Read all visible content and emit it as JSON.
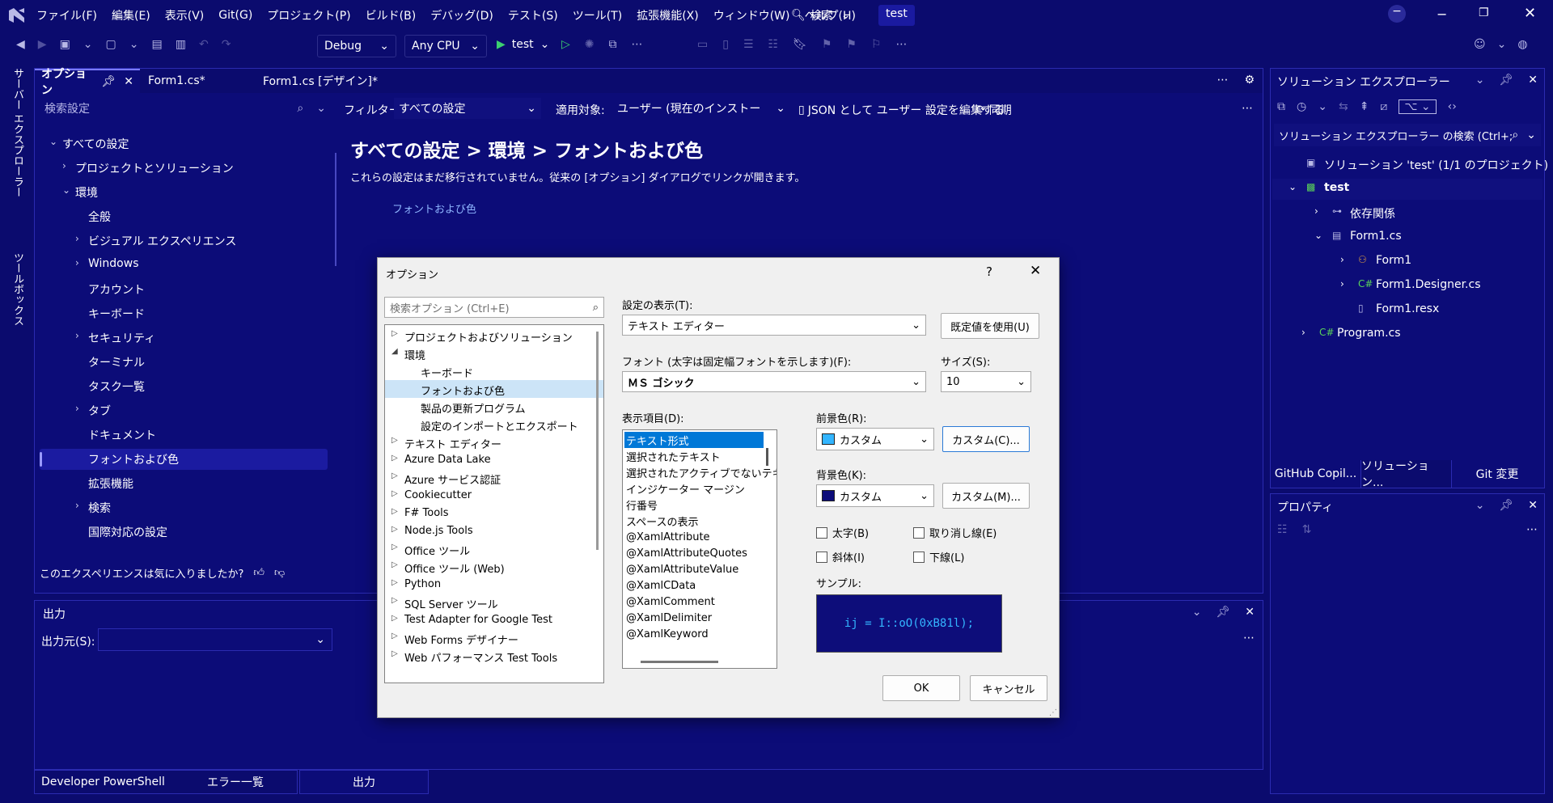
{
  "app": {
    "logo": "vs-logo-icon",
    "solution_name": "test"
  },
  "menu": [
    "ファイル(F)",
    "編集(E)",
    "表示(V)",
    "Git(G)",
    "プロジェクト(P)",
    "ビルド(B)",
    "デバッグ(D)",
    "テスト(S)",
    "ツール(T)",
    "拡張機能(X)",
    "ウィンドウ(W)",
    "ヘルプ(H)"
  ],
  "search_label": "検索",
  "toolbar": {
    "config": "Debug",
    "platform": "Any CPU",
    "run_target": "test"
  },
  "left_vertical_tabs": [
    "サーバー エクスプローラー",
    "ツールボックス"
  ],
  "doc_tabs": [
    {
      "label": "オプション"
    },
    {
      "label": "Form1.cs*"
    },
    {
      "label": "Form1.cs [デザイン]*"
    }
  ],
  "options_page": {
    "search_placeholder": "検索設定",
    "filter_label": "フィルター:",
    "filter_value": "すべての設定",
    "scope_label": "適用対象:",
    "scope_value": "ユーザー (現在のインストー",
    "json_edit": "JSON として ユーザー 設定を編集する",
    "sync": "同期",
    "breadcrumb": "すべての設定 > 環境 > フォントおよび色",
    "notice": "これらの設定はまだ移行されていません。従来の [オプション] ダイアログでリンクが開きます。",
    "link": "フォントおよび色",
    "feedback": "このエクスペリエンスは気に入りましたか?",
    "tree": [
      {
        "label": "すべての設定",
        "level": 0,
        "arrow": "v"
      },
      {
        "label": "プロジェクトとソリューション",
        "level": 1,
        "arrow": ">"
      },
      {
        "label": "環境",
        "level": 1,
        "arrow": "v"
      },
      {
        "label": "全般",
        "level": 2,
        "arrow": ""
      },
      {
        "label": "ビジュアル エクスペリエンス",
        "level": 2,
        "arrow": ">"
      },
      {
        "label": "Windows",
        "level": 2,
        "arrow": ">"
      },
      {
        "label": "アカウント",
        "level": 2,
        "arrow": ""
      },
      {
        "label": "キーボード",
        "level": 2,
        "arrow": ""
      },
      {
        "label": "セキュリティ",
        "level": 2,
        "arrow": ">"
      },
      {
        "label": "ターミナル",
        "level": 2,
        "arrow": ""
      },
      {
        "label": "タスク一覧",
        "level": 2,
        "arrow": ""
      },
      {
        "label": "タブ",
        "level": 2,
        "arrow": ">"
      },
      {
        "label": "ドキュメント",
        "level": 2,
        "arrow": ""
      },
      {
        "label": "フォントおよび色",
        "level": 2,
        "arrow": "",
        "selected": true
      },
      {
        "label": "拡張機能",
        "level": 2,
        "arrow": ""
      },
      {
        "label": "検索",
        "level": 2,
        "arrow": ">"
      },
      {
        "label": "国際対応の設定",
        "level": 2,
        "arrow": ""
      }
    ]
  },
  "output_panel": {
    "title": "出力",
    "source_label": "出力元(S):"
  },
  "bottom_tabs": [
    "Developer PowerShell",
    "エラー一覧",
    "出力"
  ],
  "solution_explorer": {
    "title": "ソリューション エクスプローラー",
    "search_placeholder": "ソリューション エクスプローラー の検索 (Ctrl+;)",
    "items": [
      {
        "label": "ソリューション 'test' (1/1 のプロジェクト)",
        "level": 0,
        "arrow": "",
        "icon": "solution-icon"
      },
      {
        "label": "test",
        "level": 0,
        "arrow": "v",
        "icon": "csharp-project-icon",
        "bold": true
      },
      {
        "label": "依存関係",
        "level": 1,
        "arrow": ">",
        "icon": "dependencies-icon"
      },
      {
        "label": "Form1.cs",
        "level": 1,
        "arrow": "v",
        "icon": "form-icon"
      },
      {
        "label": "Form1",
        "level": 2,
        "arrow": ">",
        "icon": "class-icon"
      },
      {
        "label": "Form1.Designer.cs",
        "level": 2,
        "arrow": ">",
        "icon": "csharp-file-icon"
      },
      {
        "label": "Form1.resx",
        "level": 2,
        "arrow": "",
        "icon": "resx-file-icon"
      },
      {
        "label": "Program.cs",
        "level": 0.5,
        "arrow": ">",
        "icon": "csharp-file-icon"
      }
    ],
    "tabs": [
      "GitHub Copil...",
      "ソリューション...",
      "Git 変更"
    ]
  },
  "properties": {
    "title": "プロパティ"
  },
  "dialog": {
    "title": "オプション",
    "help": "?",
    "search_placeholder": "検索オプション (Ctrl+E)",
    "tree": [
      {
        "label": "プロジェクトおよびソリューション",
        "arrow": "▷",
        "level": 0
      },
      {
        "label": "環境",
        "arrow": "◢",
        "level": 0
      },
      {
        "label": "キーボード",
        "arrow": "",
        "level": 1
      },
      {
        "label": "フォントおよび色",
        "arrow": "",
        "level": 1,
        "selected": true
      },
      {
        "label": "製品の更新プログラム",
        "arrow": "",
        "level": 1
      },
      {
        "label": "設定のインポートとエクスポート",
        "arrow": "",
        "level": 1
      },
      {
        "label": "テキスト エディター",
        "arrow": "▷",
        "level": 0
      },
      {
        "label": "Azure Data Lake",
        "arrow": "▷",
        "level": 0
      },
      {
        "label": "Azure サービス認証",
        "arrow": "▷",
        "level": 0
      },
      {
        "label": "Cookiecutter",
        "arrow": "▷",
        "level": 0
      },
      {
        "label": "F# Tools",
        "arrow": "▷",
        "level": 0
      },
      {
        "label": "Node.js Tools",
        "arrow": "▷",
        "level": 0
      },
      {
        "label": "Office ツール",
        "arrow": "▷",
        "level": 0
      },
      {
        "label": "Office ツール (Web)",
        "arrow": "▷",
        "level": 0
      },
      {
        "label": "Python",
        "arrow": "▷",
        "level": 0
      },
      {
        "label": "SQL Server ツール",
        "arrow": "▷",
        "level": 0
      },
      {
        "label": "Test Adapter for Google Test",
        "arrow": "▷",
        "level": 0
      },
      {
        "label": "Web Forms デザイナー",
        "arrow": "▷",
        "level": 0
      },
      {
        "label": "Web パフォーマンス Test Tools",
        "arrow": "▷",
        "level": 0
      }
    ],
    "show_settings_label": "設定の表示(T):",
    "show_settings_value": "テキスト エディター",
    "use_defaults": "既定値を使用(U)",
    "font_label": "フォント (太字は固定幅フォントを示します)(F):",
    "font_value": "ＭＳ ゴシック",
    "size_label": "サイズ(S):",
    "size_value": "10",
    "display_items_label": "表示項目(D):",
    "display_items": [
      "テキスト形式",
      "選択されたテキスト",
      "選択されたアクティブでないテキスト",
      "インジケーター マージン",
      "行番号",
      "スペースの表示",
      "@XamlAttribute",
      "@XamlAttributeQuotes",
      "@XamlAttributeValue",
      "@XamlCData",
      "@XamlComment",
      "@XamlDelimiter",
      "@XamlKeyword"
    ],
    "fg_label": "前景色(R):",
    "fg_value": "カスタム",
    "fg_color": "#33b5ff",
    "fg_custom": "カスタム(C)...",
    "bg_label": "背景色(K):",
    "bg_value": "カスタム",
    "bg_color": "#0d0d7a",
    "bg_custom": "カスタム(M)...",
    "bold": "太字(B)",
    "strike": "取り消し線(E)",
    "italic": "斜体(I)",
    "underline": "下線(L)",
    "sample_label": "サンプル:",
    "sample_text": "ij = I::oO(0xB81l);",
    "ok": "OK",
    "cancel": "キャンセル"
  }
}
